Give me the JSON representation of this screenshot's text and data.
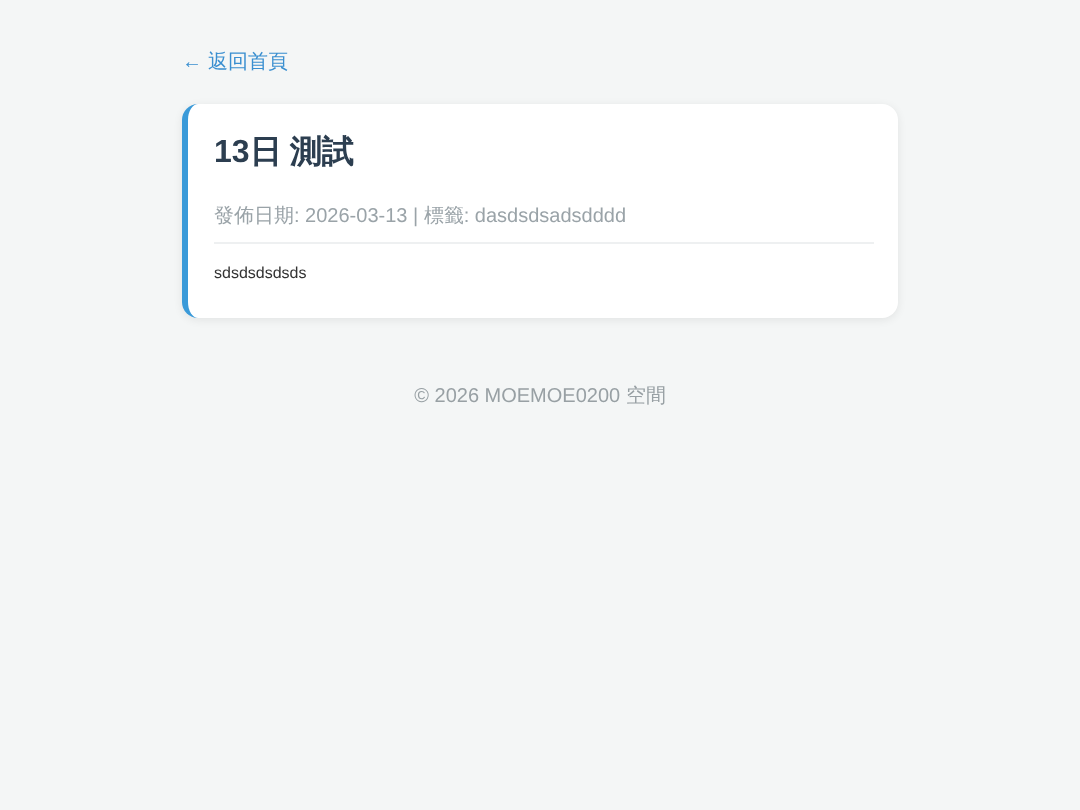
{
  "back_link": "← 返回首頁",
  "post": {
    "title": "13日 測試",
    "meta": "發佈日期: 2026-03-13 | 標籤: dasdsdsadsdddd",
    "body": "sdsdsdsdsds"
  },
  "footer": "© 2026 MOEMOE0200 空間"
}
